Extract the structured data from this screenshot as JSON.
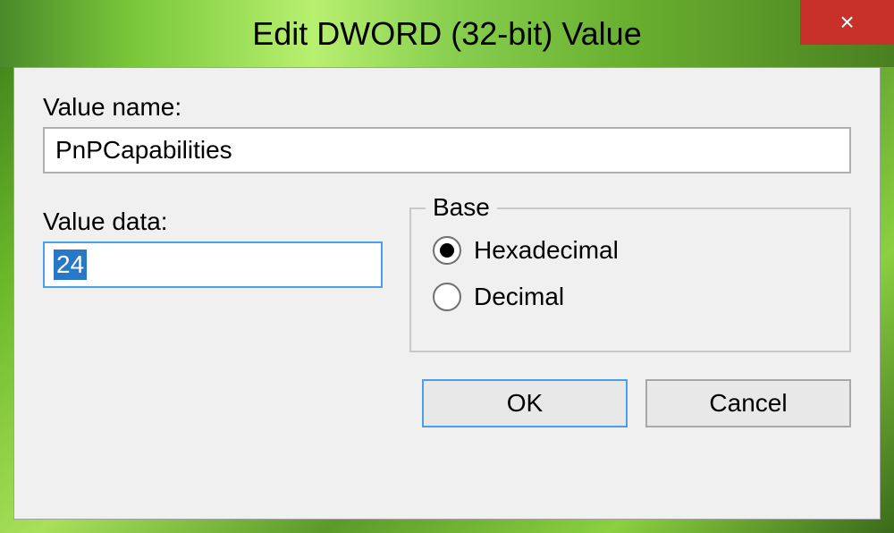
{
  "dialog": {
    "title": "Edit DWORD (32-bit) Value",
    "close_icon": "×",
    "value_name_label": "Value name:",
    "value_name": "PnPCapabilities",
    "value_data_label": "Value data:",
    "value_data": "24",
    "base": {
      "legend": "Base",
      "hexadecimal": "Hexadecimal",
      "decimal": "Decimal",
      "selected": "hexadecimal"
    },
    "buttons": {
      "ok": "OK",
      "cancel": "Cancel"
    }
  }
}
